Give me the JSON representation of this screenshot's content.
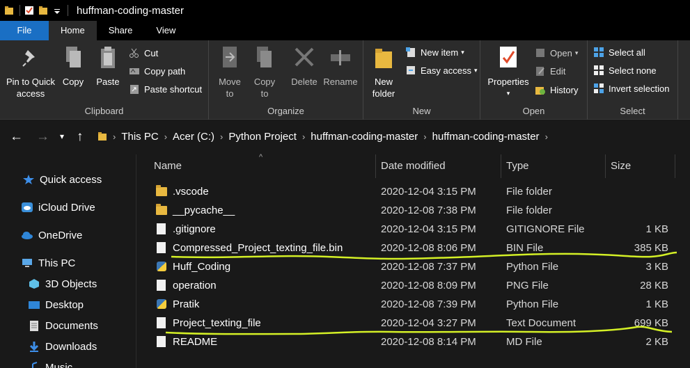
{
  "window": {
    "title": "huffman-coding-master"
  },
  "tabs": [
    {
      "label": "File"
    },
    {
      "label": "Home"
    },
    {
      "label": "Share"
    },
    {
      "label": "View"
    }
  ],
  "ribbon": {
    "clipboard": {
      "label": "Clipboard",
      "pin_line1": "Pin to Quick",
      "pin_line2": "access",
      "copy": "Copy",
      "paste": "Paste",
      "cut": "Cut",
      "copy_path": "Copy path",
      "paste_shortcut": "Paste shortcut"
    },
    "organize": {
      "label": "Organize",
      "move_to_line1": "Move",
      "move_to_line2": "to",
      "copy_to_line1": "Copy",
      "copy_to_line2": "to",
      "delete": "Delete",
      "rename": "Rename"
    },
    "new": {
      "label": "New",
      "new_folder_line1": "New",
      "new_folder_line2": "folder",
      "new_item": "New item",
      "easy_access": "Easy access"
    },
    "open": {
      "label": "Open",
      "properties": "Properties",
      "open": "Open",
      "edit": "Edit",
      "history": "History"
    },
    "select": {
      "label": "Select",
      "select_all": "Select all",
      "select_none": "Select none",
      "invert_selection": "Invert selection"
    }
  },
  "breadcrumb": [
    "This PC",
    "Acer (C:)",
    "Python Project",
    "huffman-coding-master",
    "huffman-coding-master"
  ],
  "sidebar": [
    {
      "label": "Quick access",
      "icon": "star-icon"
    },
    {
      "label": "iCloud Drive",
      "icon": "icloud-icon"
    },
    {
      "label": "OneDrive",
      "icon": "onedrive-icon"
    },
    {
      "label": "This PC",
      "icon": "this-pc-icon"
    },
    {
      "label": "3D Objects",
      "icon": "3d-objects-icon"
    },
    {
      "label": "Desktop",
      "icon": "desktop-icon"
    },
    {
      "label": "Documents",
      "icon": "documents-icon"
    },
    {
      "label": "Downloads",
      "icon": "downloads-icon"
    },
    {
      "label": "Music",
      "icon": "music-icon"
    }
  ],
  "columns": {
    "name": "Name",
    "date": "Date modified",
    "type": "Type",
    "size": "Size"
  },
  "files": [
    {
      "name": ".vscode",
      "date": "2020-12-04 3:15 PM",
      "type": "File folder",
      "size": "",
      "icon": "folder-icon"
    },
    {
      "name": "__pycache__",
      "date": "2020-12-08 7:38 PM",
      "type": "File folder",
      "size": "",
      "icon": "folder-icon"
    },
    {
      "name": ".gitignore",
      "date": "2020-12-04 3:15 PM",
      "type": "GITIGNORE File",
      "size": "1 KB",
      "icon": "file-icon"
    },
    {
      "name": "Compressed_Project_texting_file.bin",
      "date": "2020-12-08 8:06 PM",
      "type": "BIN File",
      "size": "385 KB",
      "icon": "file-icon"
    },
    {
      "name": "Huff_Coding",
      "date": "2020-12-08 7:37 PM",
      "type": "Python File",
      "size": "3 KB",
      "icon": "python-file-icon"
    },
    {
      "name": "operation",
      "date": "2020-12-08 8:09 PM",
      "type": "PNG File",
      "size": "28 KB",
      "icon": "file-icon"
    },
    {
      "name": "Pratik",
      "date": "2020-12-08 7:39 PM",
      "type": "Python File",
      "size": "1 KB",
      "icon": "python-file-icon"
    },
    {
      "name": "Project_texting_file",
      "date": "2020-12-04 3:27 PM",
      "type": "Text Document",
      "size": "699 KB",
      "icon": "file-icon"
    },
    {
      "name": "README",
      "date": "2020-12-08 8:14 PM",
      "type": "MD File",
      "size": "2 KB",
      "icon": "file-icon"
    }
  ],
  "colors": {
    "accent": "#1a6fc4",
    "highlight": "#d4f026",
    "background": "#191919",
    "ribbon": "#2b2b2b"
  }
}
